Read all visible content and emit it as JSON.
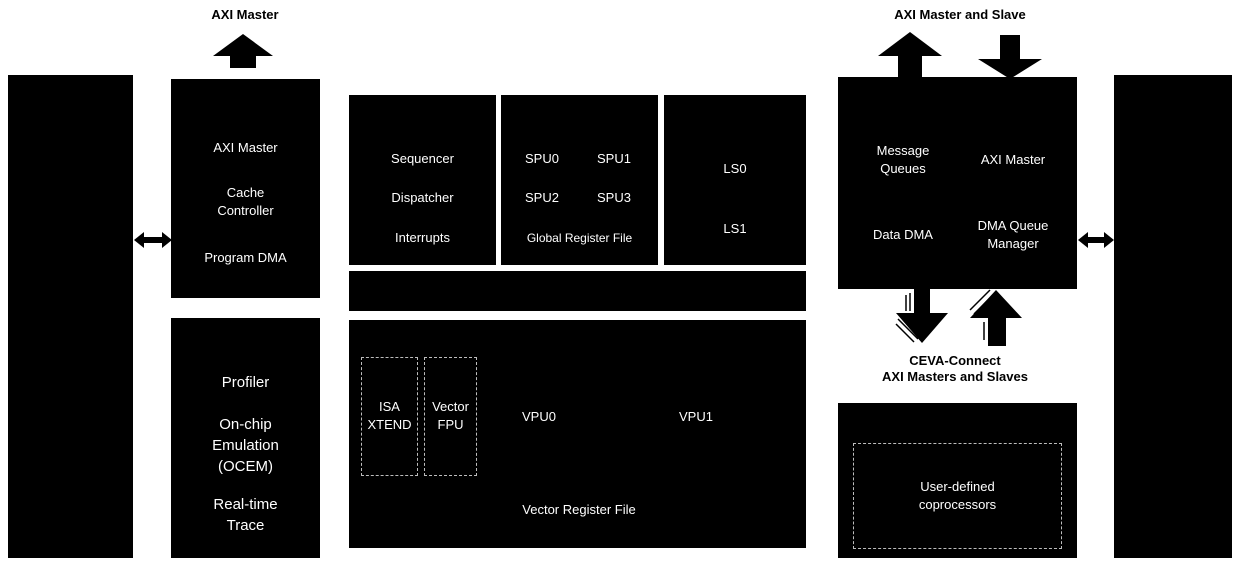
{
  "colors": {
    "block": "#000000",
    "block_text": "#ffffff",
    "label_text": "#000000",
    "dashed_border": "#bdbdbd",
    "background": "#ffffff"
  },
  "labels": {
    "axi_master_top": "AXI Master",
    "axi_master_slave_top": "AXI Master and Slave",
    "ceva_connect_line1": "CEVA-Connect",
    "ceva_connect_line2": "AXI Masters and Slaves"
  },
  "blocks": {
    "program_memory": {
      "axi_master": "AXI Master",
      "cache_line1": "Cache",
      "cache_line2": "Controller",
      "program_dma": "Program DMA"
    },
    "debug": {
      "profiler": "Profiler",
      "ocem_line1": "On-chip",
      "ocem_line2": "Emulation",
      "ocem_line3": "(OCEM)",
      "trace_line1": "Real-time",
      "trace_line2": "Trace"
    },
    "control": {
      "sequencer": "Sequencer",
      "dispatcher": "Dispatcher",
      "interrupts": "Interrupts"
    },
    "spu": {
      "spu0": "SPU0",
      "spu1": "SPU1",
      "spu2": "SPU2",
      "spu3": "SPU3",
      "grf": "Global Register File"
    },
    "ls": {
      "ls0": "LS0",
      "ls1": "LS1"
    },
    "vector": {
      "isa_line1": "ISA",
      "isa_line2": "XTEND",
      "fpu_line1": "Vector",
      "fpu_line2": "FPU",
      "vpu0": "VPU0",
      "vpu1": "VPU1",
      "vrf": "Vector Register File"
    },
    "data_memory": {
      "mq_line1": "Message",
      "mq_line2": "Queues",
      "axi_master": "AXI Master",
      "data_dma": "Data DMA",
      "dqm_line1": "DMA Queue",
      "dqm_line2": "Manager"
    },
    "coprocessor": {
      "line1": "User-defined",
      "line2": "coprocessors"
    }
  }
}
